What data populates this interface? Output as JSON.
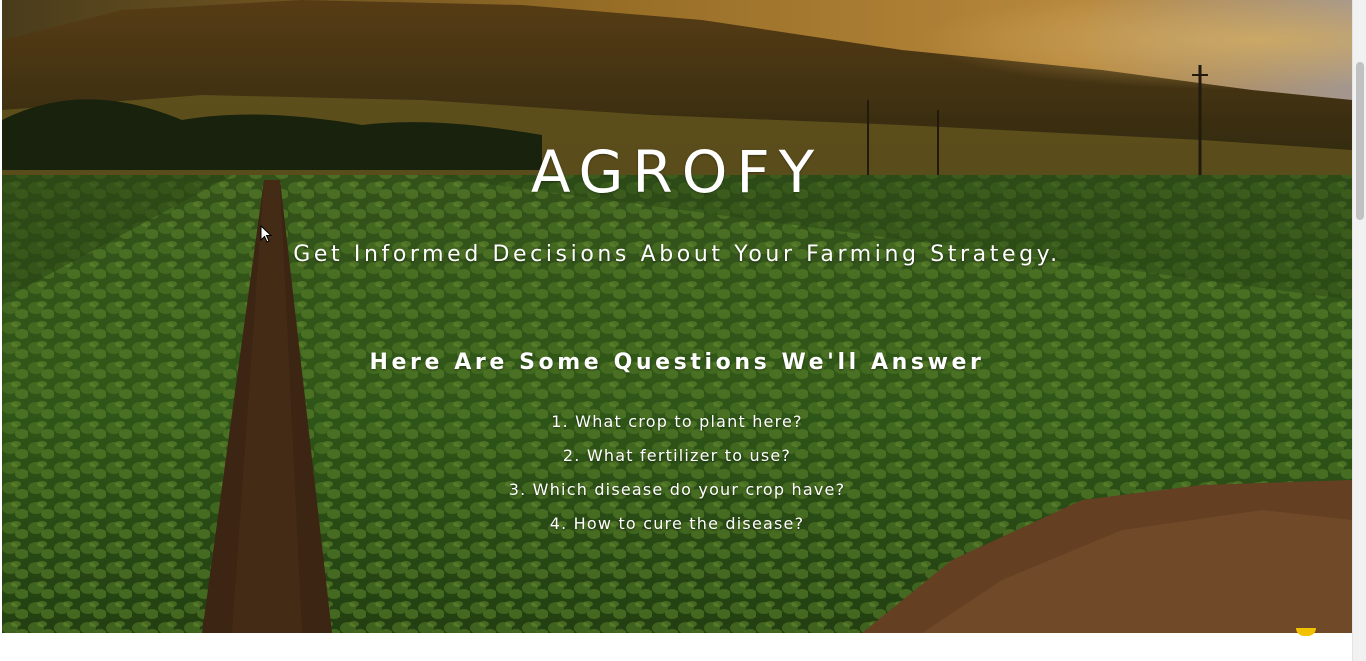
{
  "brand": {
    "title": "AGROFY"
  },
  "hero": {
    "tagline": "Get Informed Decisions About Your Farming Strategy.",
    "questions_heading": "Here Are Some Questions We'll Answer",
    "questions": [
      "1. What crop to plant here?",
      "2. What fertilizer to use?",
      "3. Which disease do your crop have?",
      "4. How to cure the disease?"
    ],
    "background_icon": "farm-field-sunset-image"
  },
  "colors": {
    "text": "#ffffff",
    "crop_green": "#3f6b1f",
    "sunset_orange": "#c8862a",
    "soil_brown": "#6b4a2a"
  }
}
